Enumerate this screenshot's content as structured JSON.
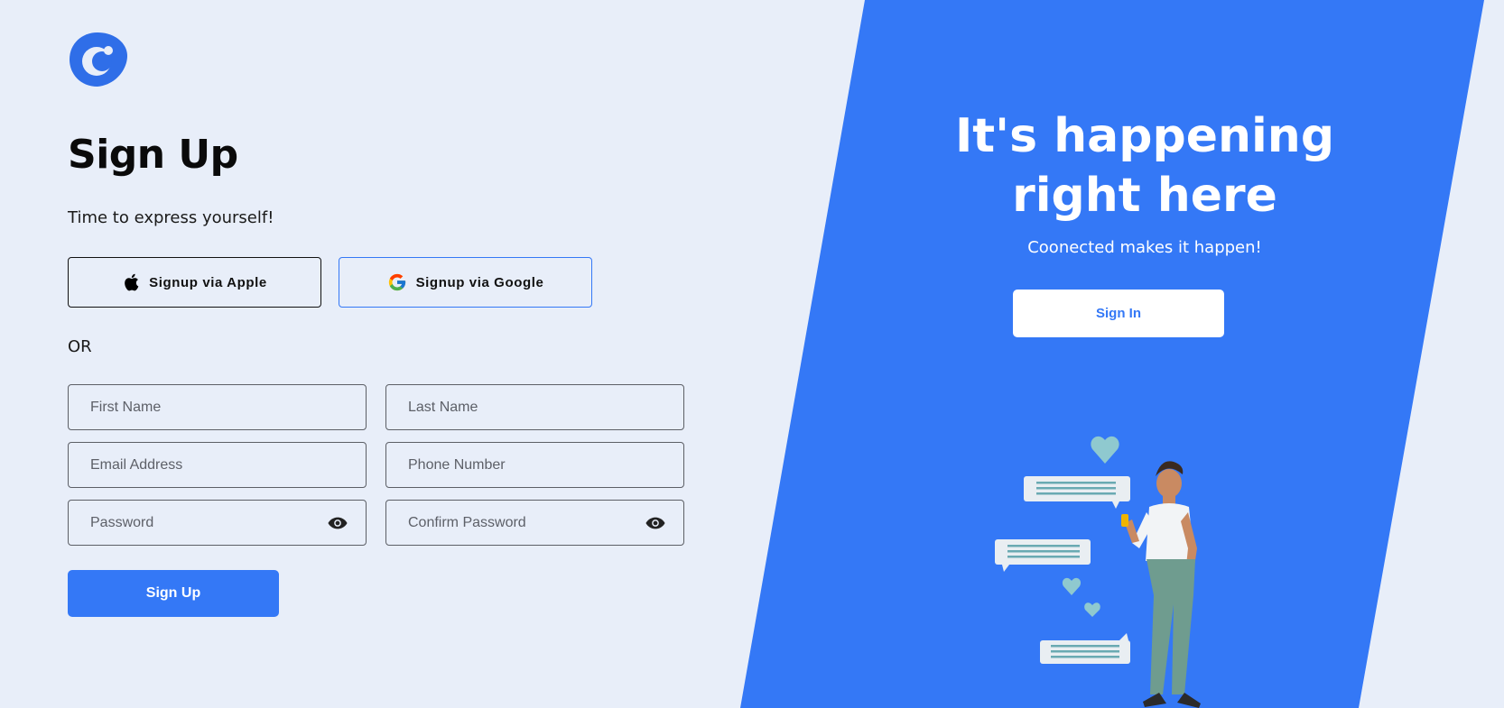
{
  "signup": {
    "title": "Sign Up",
    "subtitle": "Time to express yourself!",
    "apple_label": "Signup via Apple",
    "google_label": "Signup via Google",
    "or_text": "OR",
    "fields": {
      "first_name": {
        "placeholder": "First Name",
        "value": ""
      },
      "last_name": {
        "placeholder": "Last Name",
        "value": ""
      },
      "email": {
        "placeholder": "Email Address",
        "value": ""
      },
      "phone": {
        "placeholder": "Phone Number",
        "value": ""
      },
      "password": {
        "placeholder": "Password",
        "value": ""
      },
      "confirm_password": {
        "placeholder": "Confirm Password",
        "value": ""
      }
    },
    "submit_label": "Sign Up"
  },
  "hero": {
    "title_line1": "It's happening",
    "title_line2": "right here",
    "subtitle": "Coonected makes it happen!",
    "signin_label": "Sign In"
  },
  "icons": {
    "logo": "brand-logo",
    "apple": "apple-icon",
    "google": "google-icon",
    "eye": "eye-icon"
  },
  "colors": {
    "background": "#e8eef9",
    "accent": "#3478f6",
    "text": "#111111",
    "white": "#ffffff"
  }
}
